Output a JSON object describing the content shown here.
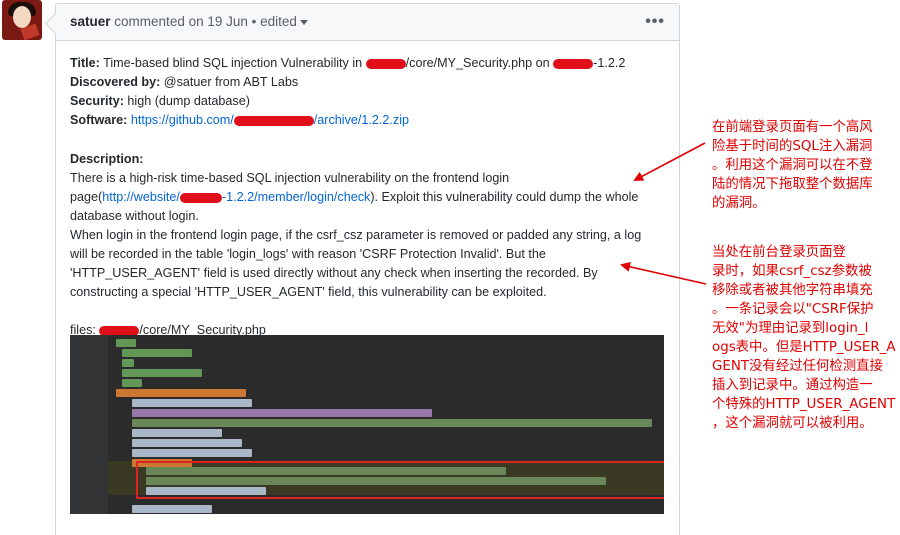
{
  "comment": {
    "author": "satuer",
    "meta": "commented on 19 Jun • edited",
    "menu_icon": "•••"
  },
  "report": {
    "title_label": "Title:",
    "title_text_a": "Time-based blind SQL injection Vulnerability in",
    "title_text_b": "/core/MY_Security.php on",
    "title_text_c": "-1.2.2",
    "discovered_label": "Discovered by:",
    "discovered_text": "@satuer from ABT Labs",
    "security_label": "Security:",
    "security_text": "high (dump database)",
    "software_label": "Software:",
    "software_link_a": "https://github.com/",
    "software_link_b": "/archive/1.2.2.zip",
    "description_label": "Description:",
    "desc_line1": "There is a high-risk time-based SQL injection vulnerability on the frontend login",
    "desc_line2_a": "page(",
    "desc_line2_link_a": "http://website/",
    "desc_line2_link_b": "-1.2.2/member/login/check",
    "desc_line2_b": "). Exploit this vulnerability could dump the whole",
    "desc_line3": "database without login.",
    "desc2_line1": "When login in the frontend login page, if the csrf_csz parameter is removed or padded any string, a log",
    "desc2_line2": "will be recorded in the table 'login_logs' with reason 'CSRF Protection Invalid'. But the",
    "desc2_line3": "'HTTP_USER_AGENT' field is used directly without any check when inserting the recorded. By",
    "desc2_line4": "constructing a special 'HTTP_USER_AGENT' field, this vulnerability can be exploited.",
    "files_label": "files:",
    "files_path": "/core/MY_Security.php"
  },
  "annotations": {
    "note1": [
      "在前端登录页面有一个高风",
      "险基于时间的SQL注入漏洞",
      "。利用这个漏洞可以在不登",
      "陆的情况下拖取整个数据库",
      "的漏洞。"
    ],
    "note2": [
      "当处在前台登录页面登",
      "录时，如果csrf_csz参数被",
      "移除或者被其他字符串填充",
      "。一条记录会以\"CSRF保护",
      "无效\"为理由记录到login_l",
      "ogs表中。但是HTTP_USER_A",
      "GENT没有经过任何检测直接",
      "插入到记录中。通过构造一",
      "个特殊的HTTP_USER_AGENT",
      "，这个漏洞就可以被利用。"
    ]
  },
  "colors": {
    "annotation": "#e00000",
    "link": "#0366d6",
    "redaction": "#e0101a",
    "code_bg": "#2b2b2b"
  }
}
